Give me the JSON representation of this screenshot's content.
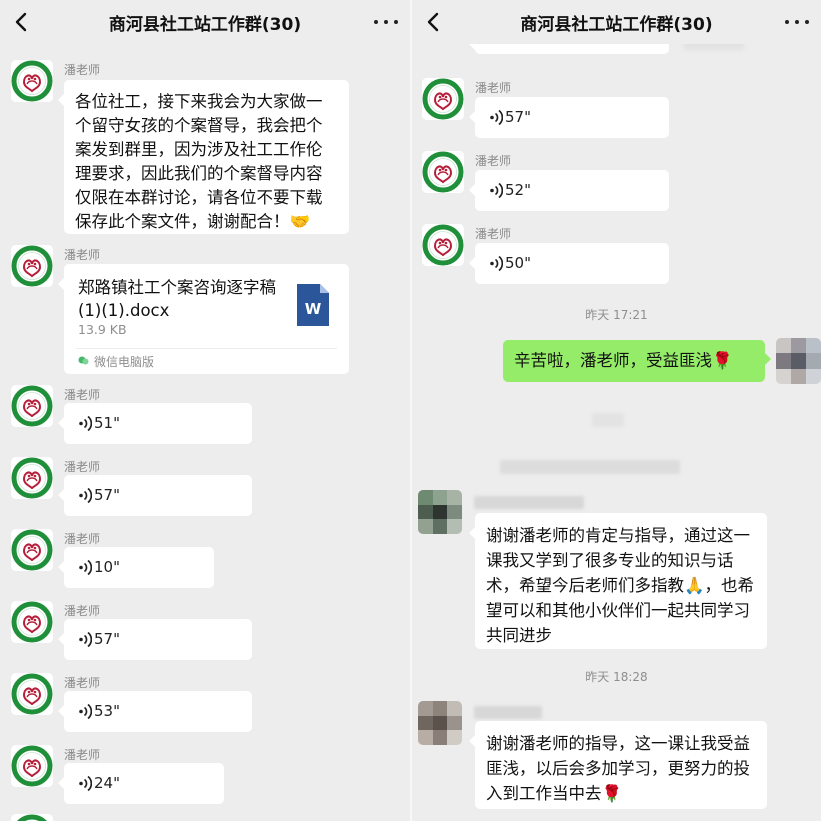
{
  "title": "商河县社工站工作群(30)",
  "colors": {
    "background": "#ededed",
    "bubble_in": "#ffffff",
    "bubble_out": "#95ec69",
    "accent_green": "#1f8f3a"
  },
  "icons": {
    "back": "chevron-left-icon",
    "more": "more-dots-icon",
    "voice": "voice-wave-icon",
    "file": "word-doc-icon",
    "source": "wechat-pc-icon"
  },
  "left": {
    "messages": [
      {
        "sender": "潘老师",
        "type": "text",
        "text": "各位社工，接下来我会为大家做一个留守女孩的个案督导，我会把个案发到群里，因为涉及社工工作伦理要求，因此我们的个案督导内容仅限在本群讨论，请各位不要下载保存此个案文件，谢谢配合！🤝"
      },
      {
        "sender": "潘老师",
        "type": "file",
        "file_name": "郑路镇社工个案咨询逐字稿(1)(1).docx",
        "file_size": "13.9 KB",
        "source": "微信电脑版"
      },
      {
        "sender": "潘老师",
        "type": "voice",
        "duration": "51\""
      },
      {
        "sender": "潘老师",
        "type": "voice",
        "duration": "57\""
      },
      {
        "sender": "潘老师",
        "type": "voice",
        "duration": "10\""
      },
      {
        "sender": "潘老师",
        "type": "voice",
        "duration": "57\""
      },
      {
        "sender": "潘老师",
        "type": "voice",
        "duration": "53\""
      },
      {
        "sender": "潘老师",
        "type": "voice",
        "duration": "24\""
      }
    ]
  },
  "right": {
    "messages": [
      {
        "sender": "潘老师",
        "type": "voice",
        "duration": "57\""
      },
      {
        "sender": "潘老师",
        "type": "voice",
        "duration": "52\""
      },
      {
        "sender": "潘老师",
        "type": "voice",
        "duration": "50\""
      }
    ],
    "time1": "昨天 17:21",
    "outgoing": "辛苦啦，潘老师，受益匪浅🌹",
    "reply1": "谢谢潘老师的肯定与指导，通过这一课我又学到了很多专业的知识与话术，希望今后老师们多指教🙏，也希望可以和其他小伙伴们一起共同学习共同进步",
    "time2": "昨天 18:28",
    "reply2": "谢谢潘老师的指导，这一课让我受益匪浅，以后会多加学习，更努力的投入到工作当中去🌹"
  }
}
